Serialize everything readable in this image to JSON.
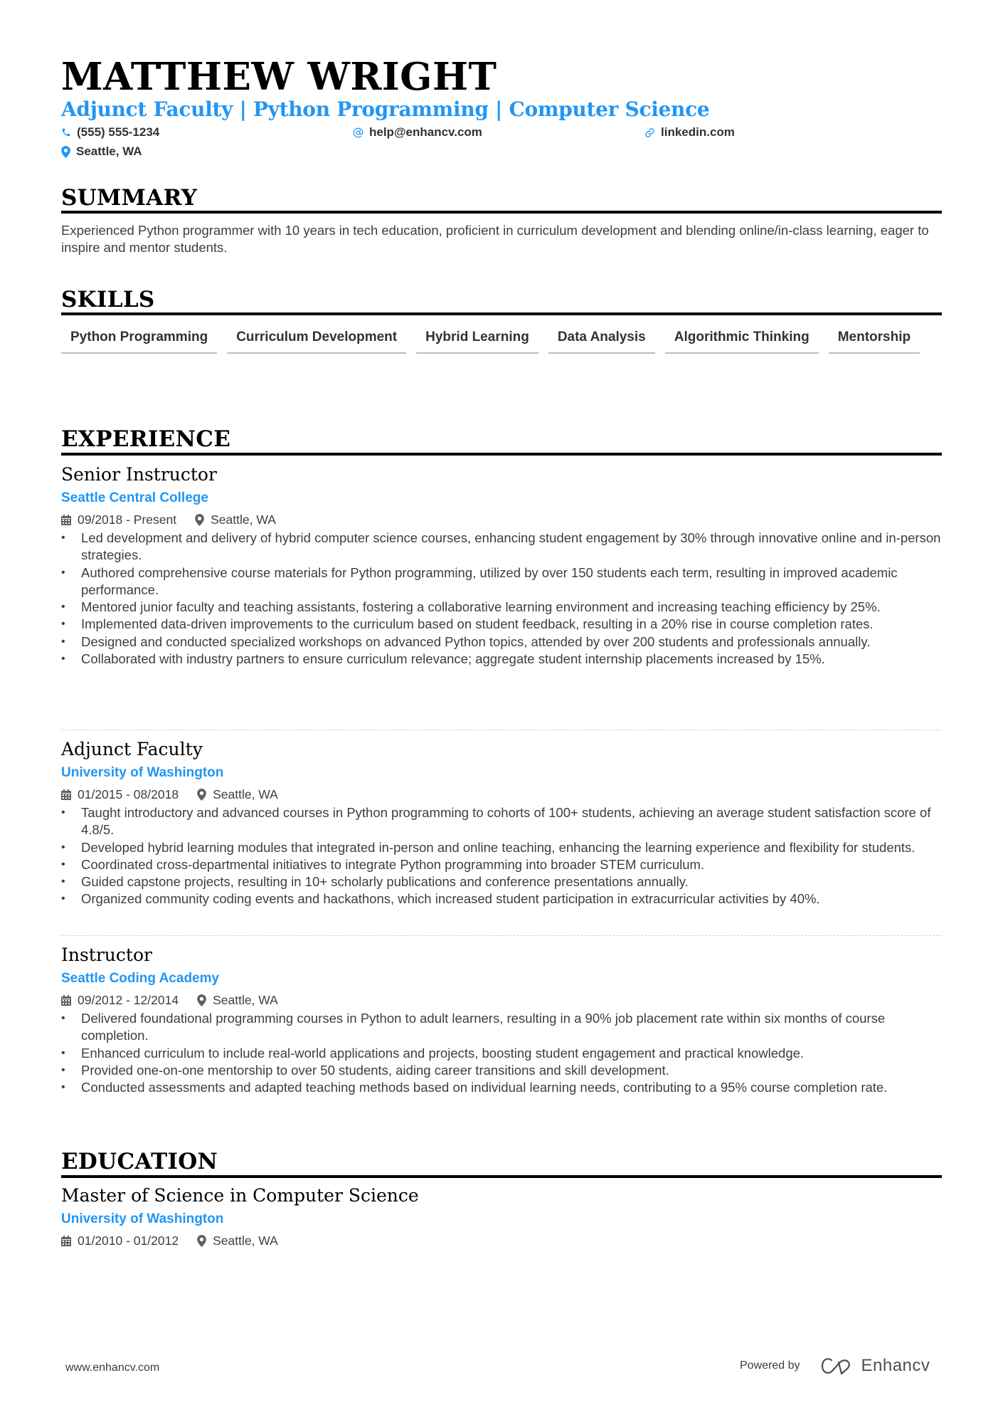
{
  "header": {
    "name": "MATTHEW WRIGHT",
    "headline": "Adjunct Faculty | Python Programming | Computer Science",
    "contacts": {
      "phone": {
        "icon": "phone-icon",
        "text": "(555) 555-1234"
      },
      "email": {
        "icon": "at-icon",
        "text": "help@enhancv.com"
      },
      "link": {
        "icon": "link-icon",
        "text": "linkedin.com"
      },
      "location": {
        "icon": "map-pin-icon",
        "text": "Seattle, WA"
      }
    }
  },
  "colors": {
    "accent": "#2196f3",
    "heading": "#000000",
    "body": "#3a3f44",
    "skill_underline": "#b9bcbf"
  },
  "summary": {
    "title": "SUMMARY",
    "text": "Experienced Python programmer with 10 years in tech education, proficient in curriculum development and blending online/in-class learning, eager to inspire and mentor students."
  },
  "skills": {
    "title": "SKILLS",
    "items": [
      "Python Programming",
      "Curriculum Development",
      "Hybrid Learning",
      "Data Analysis",
      "Algorithmic Thinking",
      "Mentorship"
    ]
  },
  "experience": {
    "title": "EXPERIENCE",
    "jobs": [
      {
        "title": "Senior Instructor",
        "org": "Seattle Central College",
        "dates": "09/2018 - Present",
        "location": "Seattle, WA",
        "bullets": [
          "Led development and delivery of hybrid computer science courses, enhancing student engagement by 30% through innovative online and in-person strategies.",
          "Authored comprehensive course materials for Python programming, utilized by over 150 students each term, resulting in improved academic performance.",
          "Mentored junior faculty and teaching assistants, fostering a collaborative learning environment and increasing teaching efficiency by 25%.",
          "Implemented data-driven improvements to the curriculum based on student feedback, resulting in a 20% rise in course completion rates.",
          "Designed and conducted specialized workshops on advanced Python topics, attended by over 200 students and professionals annually.",
          "Collaborated with industry partners to ensure curriculum relevance; aggregate student internship placements increased by 15%."
        ]
      },
      {
        "title": "Adjunct Faculty",
        "org": "University of Washington",
        "dates": "01/2015 - 08/2018",
        "location": "Seattle, WA",
        "bullets": [
          "Taught introductory and advanced courses in Python programming to cohorts of 100+ students, achieving an average student satisfaction score of 4.8/5.",
          "Developed hybrid learning modules that integrated in-person and online teaching, enhancing the learning experience and flexibility for students.",
          "Coordinated cross-departmental initiatives to integrate Python programming into broader STEM curriculum.",
          "Guided capstone projects, resulting in 10+ scholarly publications and conference presentations annually.",
          "Organized community coding events and hackathons, which increased student participation in extracurricular activities by 40%."
        ]
      },
      {
        "title": "Instructor",
        "org": "Seattle Coding Academy",
        "dates": "09/2012 - 12/2014",
        "location": "Seattle, WA",
        "bullets": [
          "Delivered foundational programming courses in Python to adult learners, resulting in a 90% job placement rate within six months of course completion.",
          "Enhanced curriculum to include real-world applications and projects, boosting student engagement and practical knowledge.",
          "Provided one-on-one mentorship to over 50 students, aiding career transitions and skill development.",
          "Conducted assessments and adapted teaching methods based on individual learning needs, contributing to a 95% course completion rate."
        ]
      }
    ]
  },
  "education": {
    "title": "EDUCATION",
    "items": [
      {
        "degree": "Master of Science in Computer Science",
        "org": "University of Washington",
        "dates": "01/2010 - 01/2012",
        "location": "Seattle, WA"
      }
    ]
  },
  "footer": {
    "website": "www.enhancv.com",
    "powered_by": "Powered by",
    "brand": "Enhancv",
    "brand_icon": "enhancv-logo-icon"
  }
}
